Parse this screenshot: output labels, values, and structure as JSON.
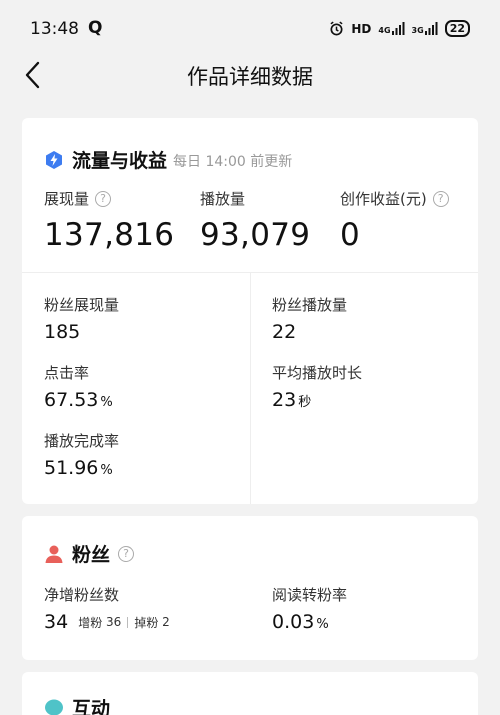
{
  "status": {
    "time": "13:48",
    "app_icon": "Q",
    "network_label": "HD",
    "net_4g": "4G",
    "net_3g": "3G",
    "battery": "22"
  },
  "nav": {
    "title": "作品详细数据"
  },
  "traffic": {
    "title": "流量与收益",
    "subtitle": "每日 14:00 前更新",
    "impressions_label": "展现量",
    "impressions_value": "137,816",
    "plays_label": "播放量",
    "plays_value": "93,079",
    "earnings_label": "创作收益(元)",
    "earnings_value": "0",
    "fan_impressions_label": "粉丝展现量",
    "fan_impressions_value": "185",
    "fan_plays_label": "粉丝播放量",
    "fan_plays_value": "22",
    "ctr_label": "点击率",
    "ctr_value": "67.53",
    "ctr_unit": "%",
    "avg_duration_label": "平均播放时长",
    "avg_duration_value": "23",
    "avg_duration_unit": "秒",
    "completion_label": "播放完成率",
    "completion_value": "51.96",
    "completion_unit": "%"
  },
  "fans": {
    "title": "粉丝",
    "net_gain_label": "净增粉丝数",
    "net_gain_value": "34",
    "gain_label": "增粉",
    "gain_value": "36",
    "loss_label": "掉粉",
    "loss_value": "2",
    "conversion_label": "阅读转粉率",
    "conversion_value": "0.03",
    "conversion_unit": "%"
  },
  "interaction": {
    "title": "互动"
  },
  "colors": {
    "traffic_icon": "#3d7cf0",
    "fans_icon": "#e8605a",
    "interaction_icon": "#4fc3c8"
  }
}
